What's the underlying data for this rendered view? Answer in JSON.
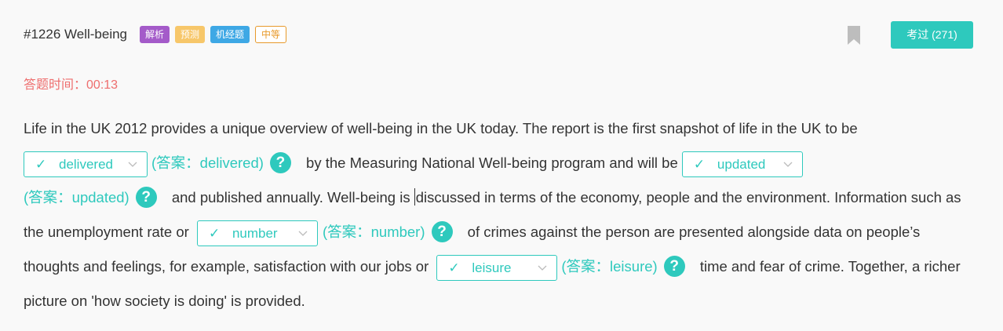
{
  "header": {
    "title": "#1226 Well-being",
    "tags": [
      "解析",
      "预测",
      "机经题",
      "中等"
    ],
    "exam_button": "考过 (271)"
  },
  "timer": {
    "label": "答题时间：",
    "value": "00:13"
  },
  "passage": {
    "seg1": "Life in the UK 2012 provides a unique overview of well-being in the UK today. The report is the first snapshot of life in the UK to be ",
    "seg2": " by the Measuring National Well-being program and will be ",
    "seg3a": " and published annually. Well-being is ",
    "seg3b": "discussed in terms of the economy, people and the environment. Information such as the unemployment rate or ",
    "seg4": " of crimes against the person are presented alongside data on people’s thoughts and feelings, for example, satisfaction with our jobs or ",
    "seg5": " time and fear of crime. Together, a richer picture on 'how society is doing' is provided."
  },
  "blanks": [
    {
      "check": "✓",
      "selected": "delivered",
      "answer_text": "(答案：delivered)",
      "help": "?"
    },
    {
      "check": "✓",
      "selected": "updated",
      "answer_text": "(答案：updated)",
      "help": "?"
    },
    {
      "check": "✓",
      "selected": "number",
      "answer_text": "(答案：number)",
      "help": "?"
    },
    {
      "check": "✓",
      "selected": "leisure",
      "answer_text": "(答案：leisure)",
      "help": "?"
    }
  ],
  "colors": {
    "accent": "#2ec9bd",
    "timer": "#ee6e6e",
    "tag_purple": "#a45bc9",
    "tag_yellow": "#f7c76a",
    "tag_blue": "#3ea8e5",
    "tag_orange": "#e89a2b"
  },
  "icons": {
    "bookmark": "bookmark-icon",
    "dropdown": "chevron-down-icon",
    "check": "check-icon",
    "help": "help-icon"
  }
}
